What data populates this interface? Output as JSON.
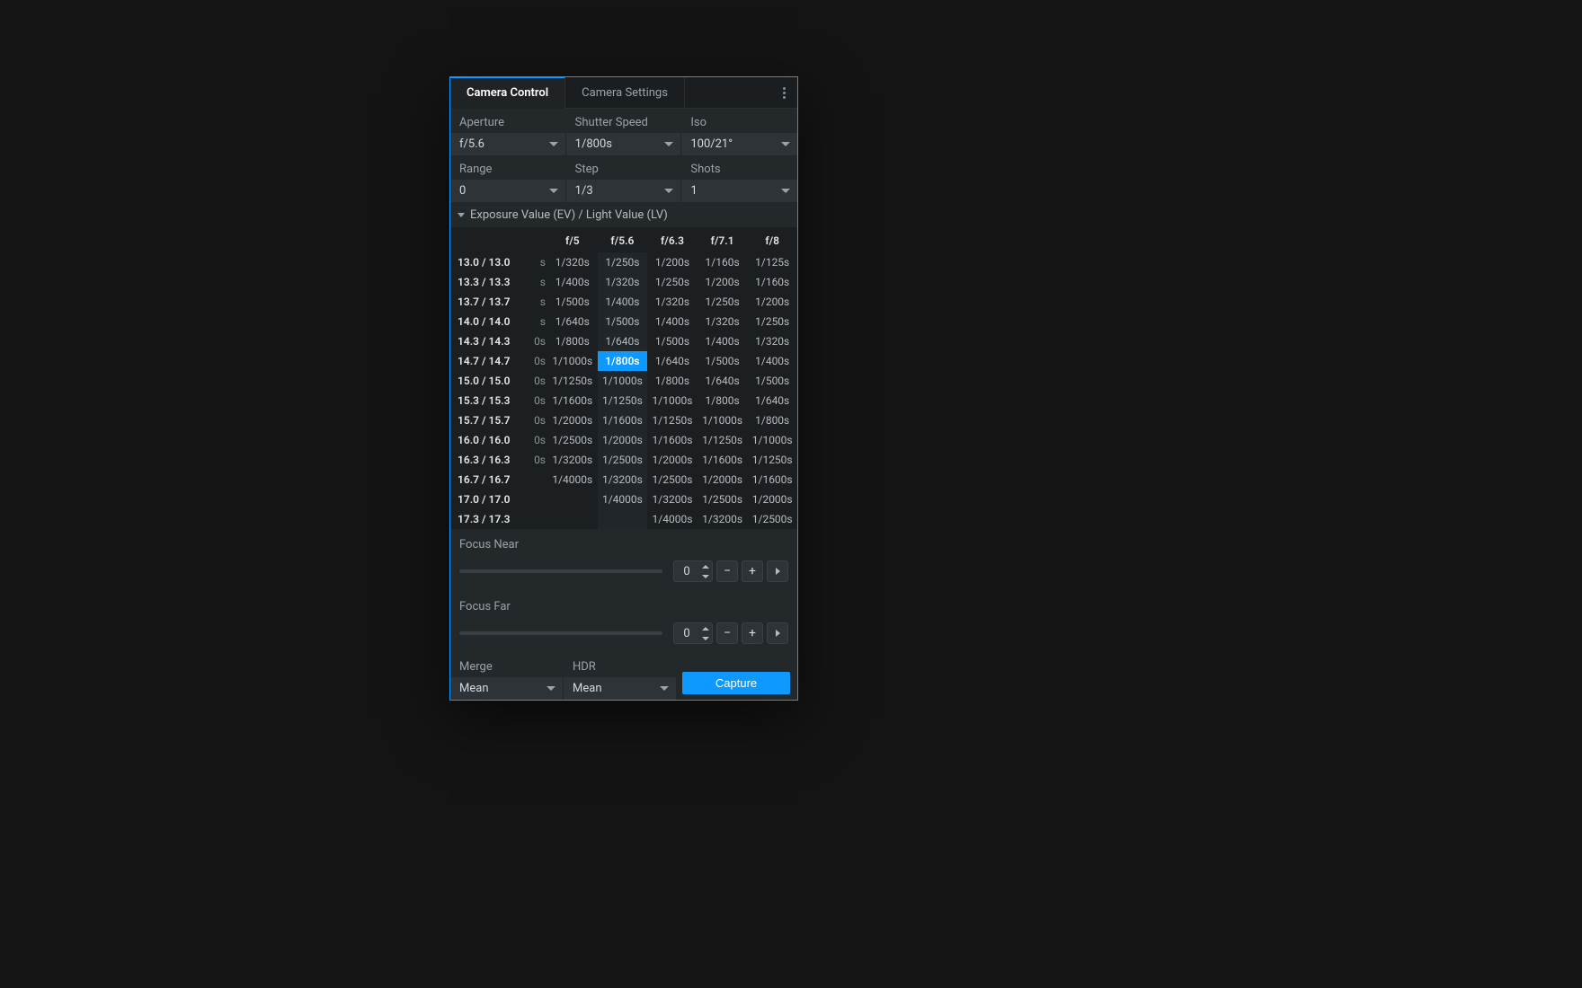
{
  "tabs": {
    "active": "Camera Control",
    "other": "Camera Settings"
  },
  "dropdowns": {
    "aperture": {
      "label": "Aperture",
      "value": "f/5.6"
    },
    "shutter": {
      "label": "Shutter Speed",
      "value": "1/800s"
    },
    "iso": {
      "label": "Iso",
      "value": "100/21°"
    },
    "range": {
      "label": "Range",
      "value": "0"
    },
    "step": {
      "label": "Step",
      "value": "1/3"
    },
    "shots": {
      "label": "Shots",
      "value": "1"
    },
    "merge": {
      "label": "Merge",
      "value": "Mean"
    },
    "hdr": {
      "label": "HDR",
      "value": "Mean"
    }
  },
  "section": {
    "title": "Exposure Value (EV) / Light Value (LV)"
  },
  "table": {
    "cols": [
      "f/5",
      "f/5.6",
      "f/6.3",
      "f/7.1",
      "f/8"
    ],
    "rows": [
      {
        "hdr": "13.0 / 13.0",
        "frag": "s",
        "cells": [
          "1/320s",
          "1/250s",
          "1/200s",
          "1/160s",
          "1/125s"
        ]
      },
      {
        "hdr": "13.3 / 13.3",
        "frag": "s",
        "cells": [
          "1/400s",
          "1/320s",
          "1/250s",
          "1/200s",
          "1/160s"
        ]
      },
      {
        "hdr": "13.7 / 13.7",
        "frag": "s",
        "cells": [
          "1/500s",
          "1/400s",
          "1/320s",
          "1/250s",
          "1/200s"
        ]
      },
      {
        "hdr": "14.0 / 14.0",
        "frag": "s",
        "cells": [
          "1/640s",
          "1/500s",
          "1/400s",
          "1/320s",
          "1/250s"
        ]
      },
      {
        "hdr": "14.3 / 14.3",
        "frag": "0s",
        "cells": [
          "1/800s",
          "1/640s",
          "1/500s",
          "1/400s",
          "1/320s"
        ]
      },
      {
        "hdr": "14.7 / 14.7",
        "frag": "0s",
        "cells": [
          "1/1000s",
          "1/800s",
          "1/640s",
          "1/500s",
          "1/400s"
        ]
      },
      {
        "hdr": "15.0 / 15.0",
        "frag": "0s",
        "cells": [
          "1/1250s",
          "1/1000s",
          "1/800s",
          "1/640s",
          "1/500s"
        ]
      },
      {
        "hdr": "15.3 / 15.3",
        "frag": "0s",
        "cells": [
          "1/1600s",
          "1/1250s",
          "1/1000s",
          "1/800s",
          "1/640s"
        ]
      },
      {
        "hdr": "15.7 / 15.7",
        "frag": "0s",
        "cells": [
          "1/2000s",
          "1/1600s",
          "1/1250s",
          "1/1000s",
          "1/800s"
        ]
      },
      {
        "hdr": "16.0 / 16.0",
        "frag": "0s",
        "cells": [
          "1/2500s",
          "1/2000s",
          "1/1600s",
          "1/1250s",
          "1/1000s"
        ]
      },
      {
        "hdr": "16.3 / 16.3",
        "frag": "0s",
        "cells": [
          "1/3200s",
          "1/2500s",
          "1/2000s",
          "1/1600s",
          "1/1250s"
        ]
      },
      {
        "hdr": "16.7 / 16.7",
        "frag": "",
        "cells": [
          "1/4000s",
          "1/3200s",
          "1/2500s",
          "1/2000s",
          "1/1600s"
        ]
      },
      {
        "hdr": "17.0 / 17.0",
        "frag": "",
        "cells": [
          "",
          "1/4000s",
          "1/3200s",
          "1/2500s",
          "1/2000s"
        ]
      },
      {
        "hdr": "17.3 / 17.3",
        "frag": "",
        "cells": [
          "",
          "",
          "1/4000s",
          "1/3200s",
          "1/2500s"
        ]
      }
    ],
    "highlight": {
      "row": 5,
      "col": 1
    }
  },
  "focus": {
    "near": {
      "label": "Focus Near",
      "value": "0"
    },
    "far": {
      "label": "Focus Far",
      "value": "0"
    }
  },
  "capture": {
    "label": "Capture"
  }
}
